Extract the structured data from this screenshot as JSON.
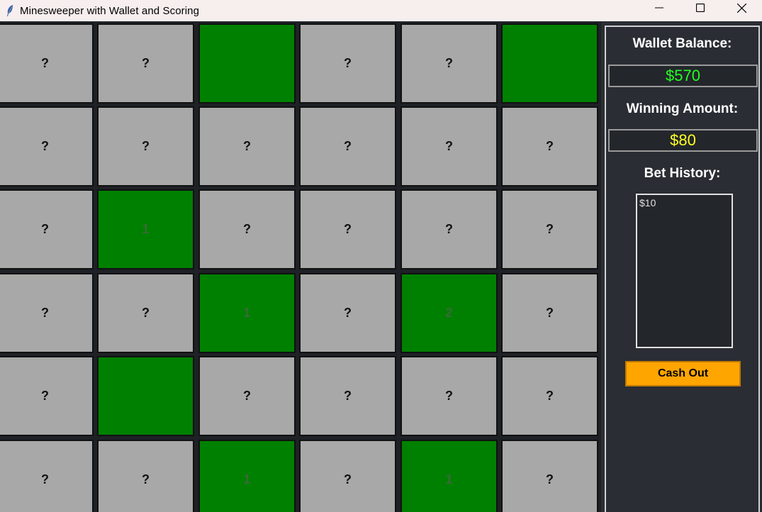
{
  "window": {
    "title": "Minesweeper with Wallet and Scoring",
    "icons": [
      "feather-icon",
      "minimize-icon",
      "maximize-icon",
      "close-icon"
    ]
  },
  "board": {
    "rows": [
      [
        "?",
        "?",
        "",
        "?",
        "?",
        ""
      ],
      [
        "?",
        "?",
        "?",
        "?",
        "?",
        "?"
      ],
      [
        "?",
        "1",
        "?",
        "?",
        "?",
        "?"
      ],
      [
        "?",
        "?",
        "1",
        "?",
        "2",
        "?"
      ],
      [
        "?",
        "",
        "?",
        "?",
        "?",
        "?"
      ],
      [
        "?",
        "?",
        "1",
        "?",
        "1",
        "?"
      ]
    ],
    "revealed": [
      [
        false,
        false,
        true,
        false,
        false,
        true
      ],
      [
        false,
        false,
        false,
        false,
        false,
        false
      ],
      [
        false,
        true,
        false,
        false,
        false,
        false
      ],
      [
        false,
        false,
        true,
        false,
        true,
        false
      ],
      [
        false,
        true,
        false,
        false,
        false,
        false
      ],
      [
        false,
        false,
        true,
        false,
        true,
        false
      ]
    ],
    "colors": {
      "hidden": "#a8a8a8",
      "revealed": "#008000"
    }
  },
  "sidebar": {
    "wallet_label": "Wallet Balance:",
    "wallet_value": "$570",
    "wallet_color": "#22ff22",
    "winning_label": "Winning Amount:",
    "winning_value": "$80",
    "winning_color": "#ffff22",
    "history_label": "Bet History:",
    "history": [
      "$10"
    ],
    "cashout_label": "Cash Out",
    "cashout_color": "#ffa500"
  }
}
